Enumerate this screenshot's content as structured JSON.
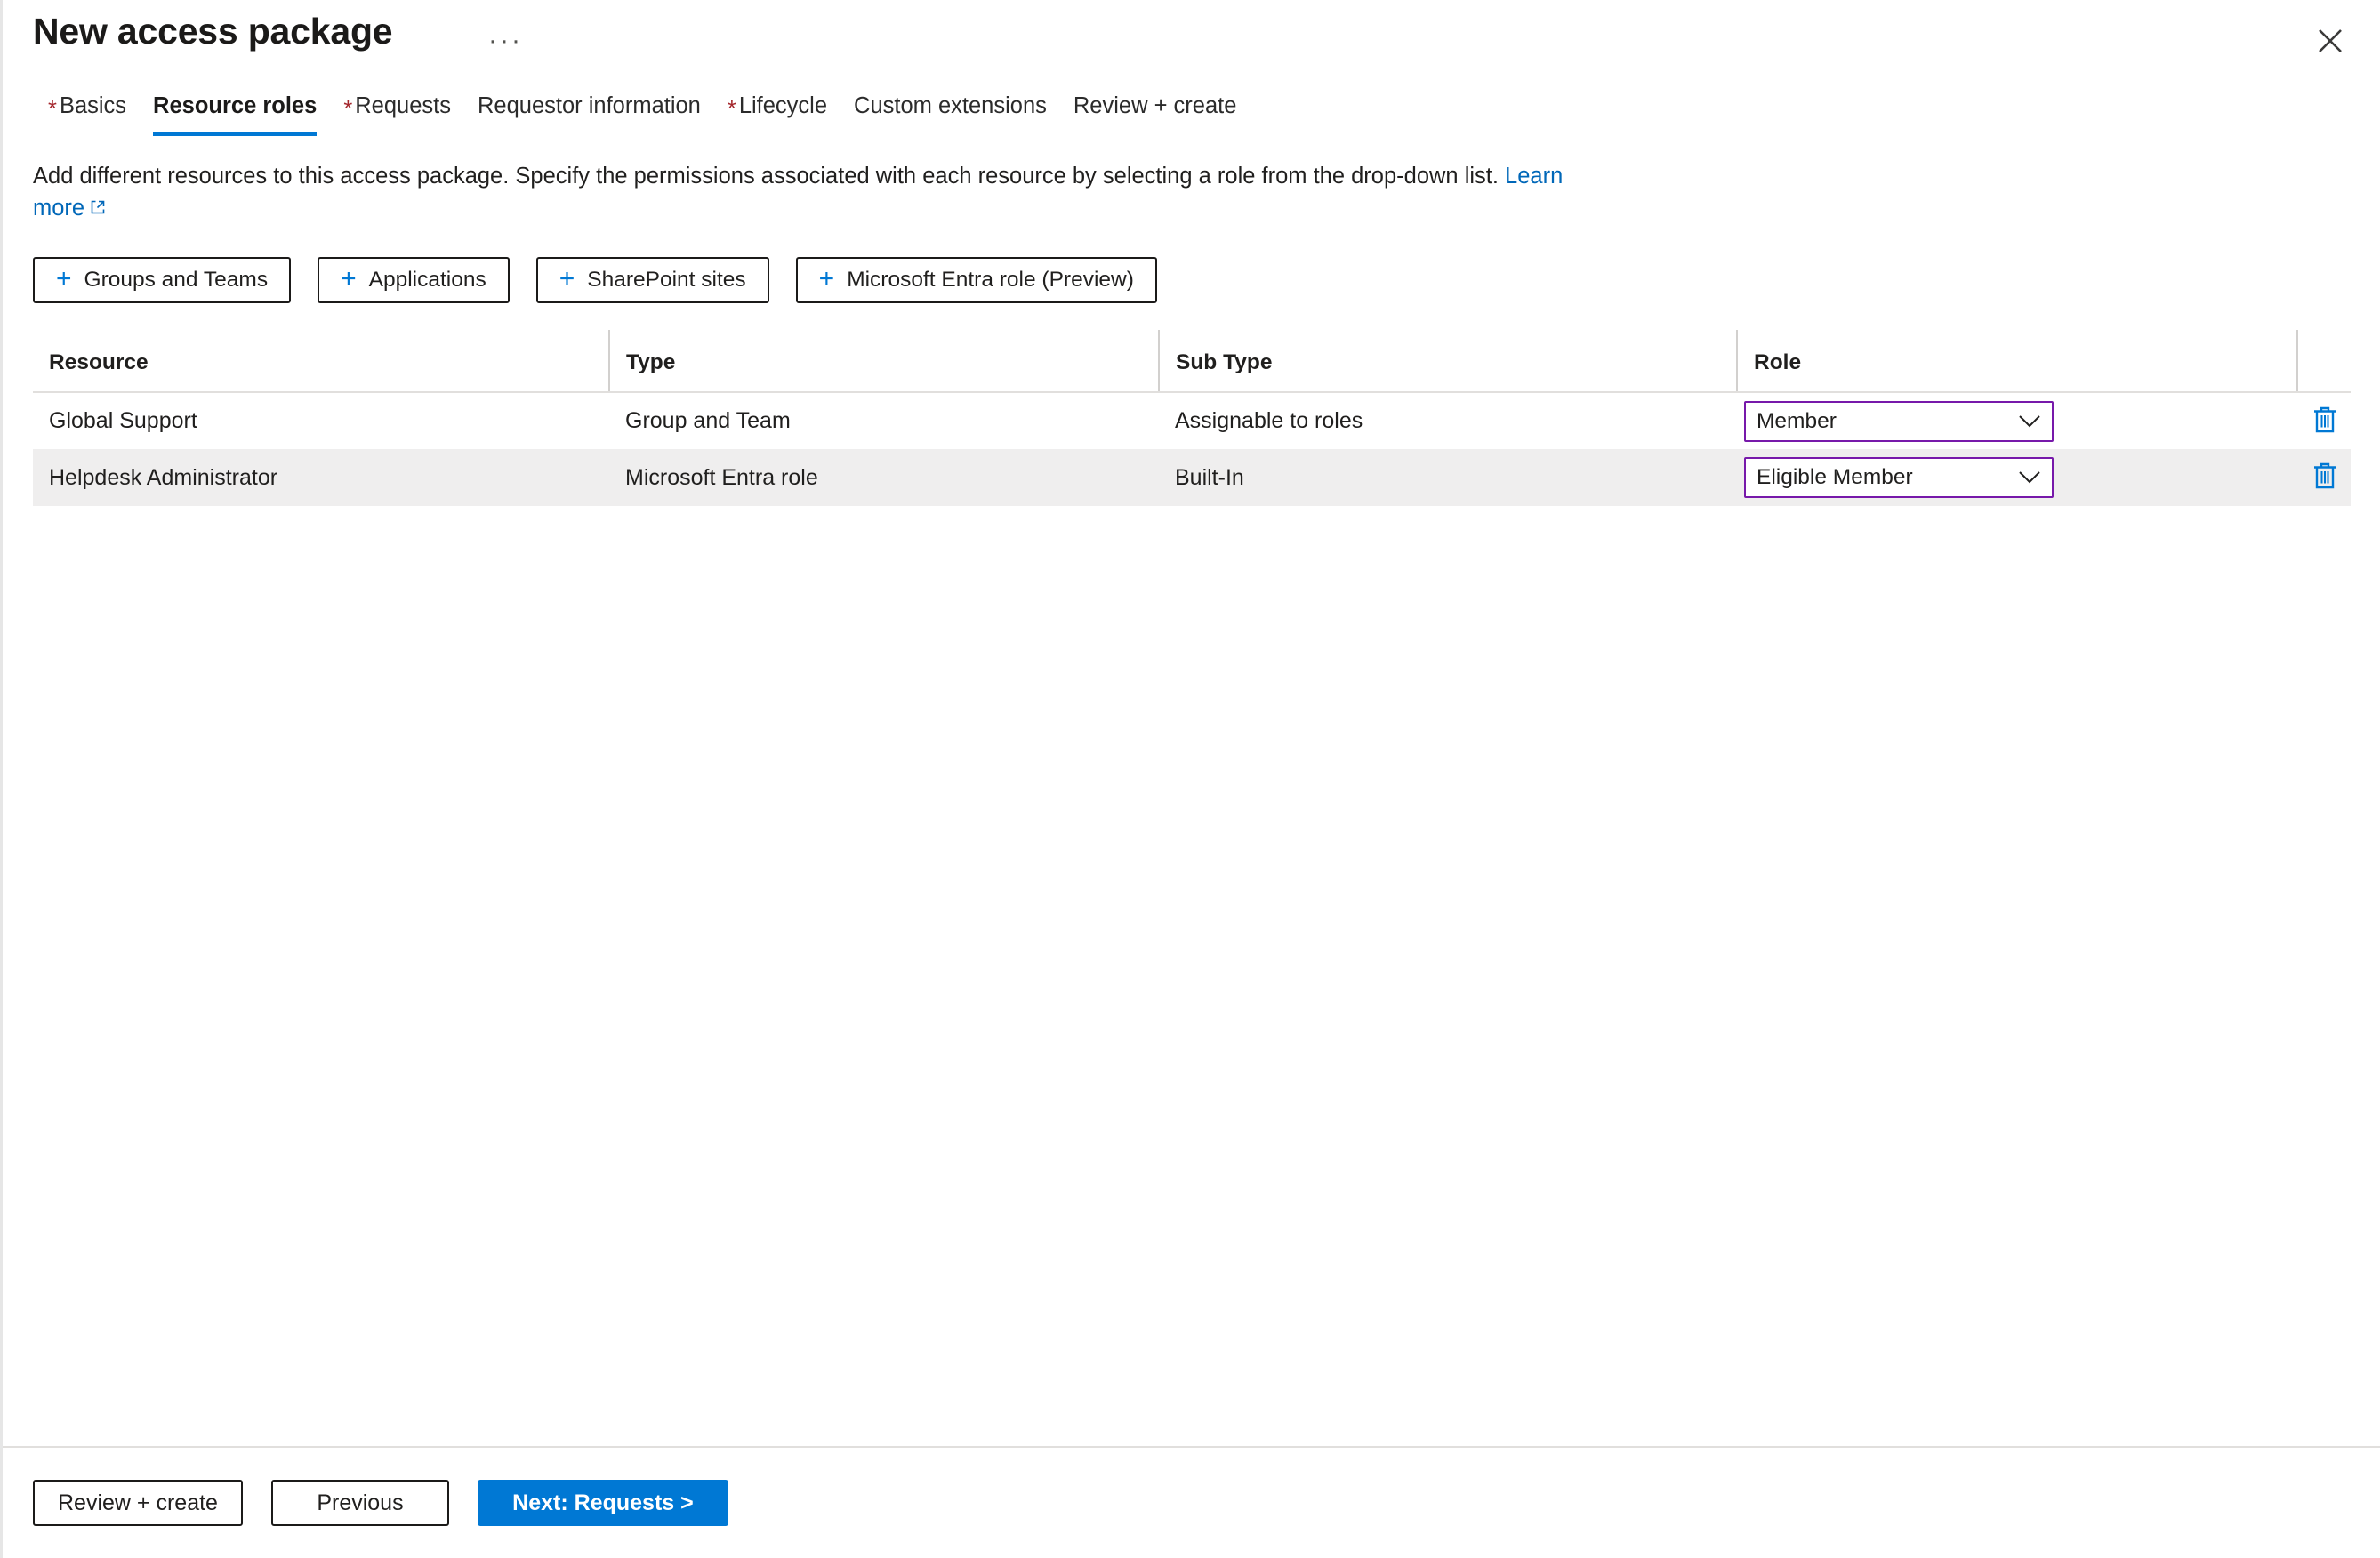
{
  "header": {
    "title": "New access package",
    "ellipsis_label": "···",
    "close_label": "Close"
  },
  "tabs": [
    {
      "label": "Basics",
      "required": true,
      "active": false
    },
    {
      "label": "Resource roles",
      "required": false,
      "active": true
    },
    {
      "label": "Requests",
      "required": true,
      "active": false
    },
    {
      "label": "Requestor information",
      "required": false,
      "active": false
    },
    {
      "label": "Lifecycle",
      "required": true,
      "active": false
    },
    {
      "label": "Custom extensions",
      "required": false,
      "active": false
    },
    {
      "label": "Review + create",
      "required": false,
      "active": false
    }
  ],
  "description": {
    "text": "Add different resources to this access package. Specify the permissions associated with each resource by selecting a role from the drop-down list.",
    "link_text": "Learn more"
  },
  "command_buttons": [
    {
      "label": "Groups and Teams",
      "icon": "plus-icon"
    },
    {
      "label": "Applications",
      "icon": "plus-icon"
    },
    {
      "label": "SharePoint sites",
      "icon": "plus-icon"
    },
    {
      "label": "Microsoft Entra role (Preview)",
      "icon": "plus-icon"
    }
  ],
  "table": {
    "columns": [
      "Resource",
      "Type",
      "Sub Type",
      "Role"
    ],
    "rows": [
      {
        "resource": "Global Support",
        "type": "Group and Team",
        "sub_type": "Assignable to roles",
        "role": "Member",
        "delete_label": "Delete"
      },
      {
        "resource": "Helpdesk Administrator",
        "type": "Microsoft Entra role",
        "sub_type": "Built-In",
        "role": "Eligible Member",
        "delete_label": "Delete"
      }
    ]
  },
  "footer": {
    "review_create": "Review + create",
    "previous": "Previous",
    "next": "Next: Requests >"
  },
  "colors": {
    "accent_blue": "#0078d4",
    "link_blue": "#0067b8",
    "required_red": "#a4262c",
    "dropdown_purple": "#7719aa",
    "alt_row": "#efeeee"
  }
}
